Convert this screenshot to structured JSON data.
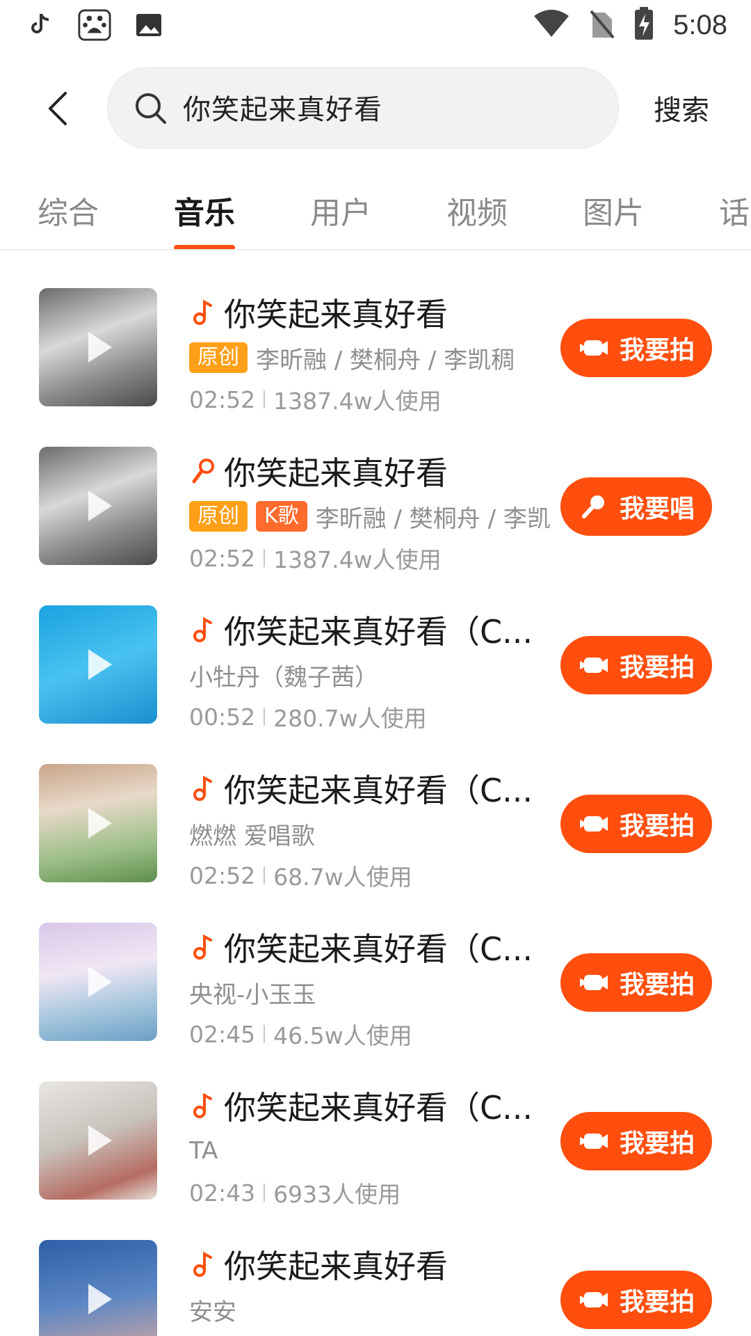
{
  "status_bar": {
    "time": "5:08",
    "left_icons": [
      "tiktok-icon",
      "baidu-icon",
      "gallery-icon"
    ],
    "right_icons": [
      "wifi-icon",
      "no-sim-icon",
      "battery-charging-icon"
    ]
  },
  "search": {
    "query": "你笑起来真好看",
    "submit_label": "搜索"
  },
  "tabs": [
    {
      "label": "综合",
      "active": false
    },
    {
      "label": "音乐",
      "active": true
    },
    {
      "label": "用户",
      "active": false
    },
    {
      "label": "视频",
      "active": false
    },
    {
      "label": "图片",
      "active": false
    },
    {
      "label": "话",
      "active": false
    }
  ],
  "colors": {
    "accent": "#ff4e0e",
    "badge_original": "#ffa018",
    "badge_karaoke": "#ff6b2c"
  },
  "results": [
    {
      "title": "你笑起来真好看",
      "icon": "music-note-icon",
      "badges": [
        "原创"
      ],
      "artist": "李昕融 / 樊桐舟 / 李凯稠",
      "duration": "02:52",
      "uses": "1387.4w人使用",
      "action": "我要拍",
      "action_icon": "video-camera-icon"
    },
    {
      "title": "你笑起来真好看",
      "icon": "microphone-icon",
      "badges": [
        "原创",
        "K歌"
      ],
      "artist": "李昕融 / 樊桐舟 / 李凯",
      "duration": "02:52",
      "uses": "1387.4w人使用",
      "action": "我要唱",
      "action_icon": "microphone-icon"
    },
    {
      "title": "你笑起来真好看（C...",
      "icon": "music-note-icon",
      "badges": [],
      "artist": "小牡丹（魏子茜）",
      "duration": "00:52",
      "uses": "280.7w人使用",
      "action": "我要拍",
      "action_icon": "video-camera-icon"
    },
    {
      "title": "你笑起来真好看（C...",
      "icon": "music-note-icon",
      "badges": [],
      "artist": "燃燃 爱唱歌",
      "duration": "02:52",
      "uses": "68.7w人使用",
      "action": "我要拍",
      "action_icon": "video-camera-icon"
    },
    {
      "title": "你笑起来真好看（C...",
      "icon": "music-note-icon",
      "badges": [],
      "artist": "央视-小玉玉",
      "duration": "02:45",
      "uses": "46.5w人使用",
      "action": "我要拍",
      "action_icon": "video-camera-icon"
    },
    {
      "title": "你笑起来真好看（C...",
      "icon": "music-note-icon",
      "badges": [],
      "artist": "TA",
      "duration": "02:43",
      "uses": "6933人使用",
      "action": "我要拍",
      "action_icon": "video-camera-icon"
    },
    {
      "title": "你笑起来真好看",
      "icon": "music-note-icon",
      "badges": [],
      "artist": "安安",
      "duration": "",
      "uses": "",
      "action": "我要拍",
      "action_icon": "video-camera-icon"
    }
  ]
}
